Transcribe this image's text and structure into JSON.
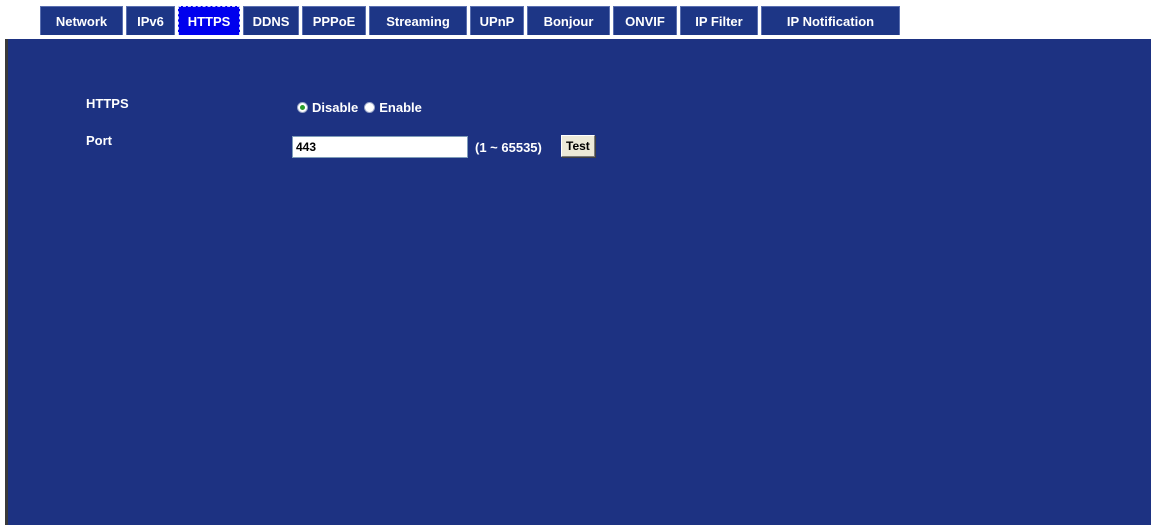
{
  "tabs": [
    {
      "label": "Network",
      "active": false
    },
    {
      "label": "IPv6",
      "active": false
    },
    {
      "label": "HTTPS",
      "active": true
    },
    {
      "label": "DDNS",
      "active": false
    },
    {
      "label": "PPPoE",
      "active": false
    },
    {
      "label": "Streaming",
      "active": false
    },
    {
      "label": "UPnP",
      "active": false
    },
    {
      "label": "Bonjour",
      "active": false
    },
    {
      "label": "ONVIF",
      "active": false
    },
    {
      "label": "IP Filter",
      "active": false
    },
    {
      "label": "IP Notification",
      "active": false
    }
  ],
  "form": {
    "https_label": "HTTPS",
    "https_options": [
      {
        "label": "Disable",
        "checked": true
      },
      {
        "label": "Enable",
        "checked": false
      }
    ],
    "port_label": "Port",
    "port_value": "443",
    "port_range": "(1 ~ 65535)",
    "test_button": "Test"
  },
  "colors": {
    "panel_background": "#1d3282",
    "tab_background": "#1d3686",
    "active_tab_background": "#0000ee",
    "text": "#ffffff"
  }
}
